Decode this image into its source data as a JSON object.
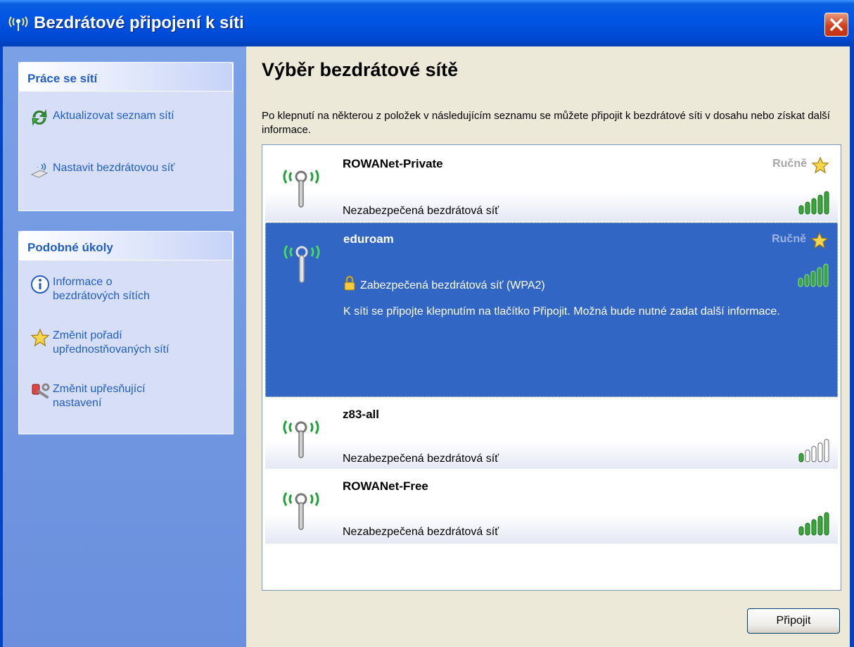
{
  "window": {
    "title": "Bezdrátové připojení k síti"
  },
  "sidebar": {
    "network_tasks": {
      "title": "Práce se sítí",
      "items": [
        {
          "label": "Aktualizovat seznam sítí",
          "icon": "refresh-icon"
        },
        {
          "label": "Nastavit bezdrátovou síť",
          "icon": "setup-wireless-icon"
        }
      ]
    },
    "related_tasks": {
      "title": "Podobné úkoly",
      "items": [
        {
          "label_line1": "Informace o",
          "label_line2": "bezdrátových sítích",
          "icon": "info-icon"
        },
        {
          "label_line1": "Změnit pořadí",
          "label_line2": "upřednostňovaných sítí",
          "icon": "star-icon"
        },
        {
          "label_line1": "Změnit upřesňující",
          "label_line2": "nastavení",
          "icon": "settings-wrench-icon"
        }
      ]
    }
  },
  "main": {
    "heading": "Výběr bezdrátové sítě",
    "description": "Po klepnutí na některou z položek v následujícím seznamu se můžete připojit k bezdrátové síti v dosahu nebo získat další informace.",
    "networks": [
      {
        "name": "ROWANet-Private",
        "security": "Nezabezpečená bezdrátová síť",
        "mode": "Ručně",
        "signal_bars": 5,
        "selected": false
      },
      {
        "name": "eduroam",
        "security": "Zabezpečená bezdrátová síť (WPA2)",
        "mode": "Ručně",
        "signal_bars": 5,
        "selected": true,
        "info": "K síti se připojte klepnutím na tlačítko Připojit. Možná bude nutné zadat další informace."
      },
      {
        "name": "z83-all",
        "security": "Nezabezpečená bezdrátová síť",
        "signal_bars": 1,
        "selected": false
      },
      {
        "name": "ROWANet-Free",
        "security": "Nezabezpečená bezdrátová síť",
        "signal_bars": 5,
        "selected": false
      }
    ],
    "connect_button": "Připojit"
  },
  "colors": {
    "titlebar": "#0055e5",
    "taskpane": "#6a8fdd",
    "selection": "#3166c5",
    "link": "#215dc6"
  }
}
